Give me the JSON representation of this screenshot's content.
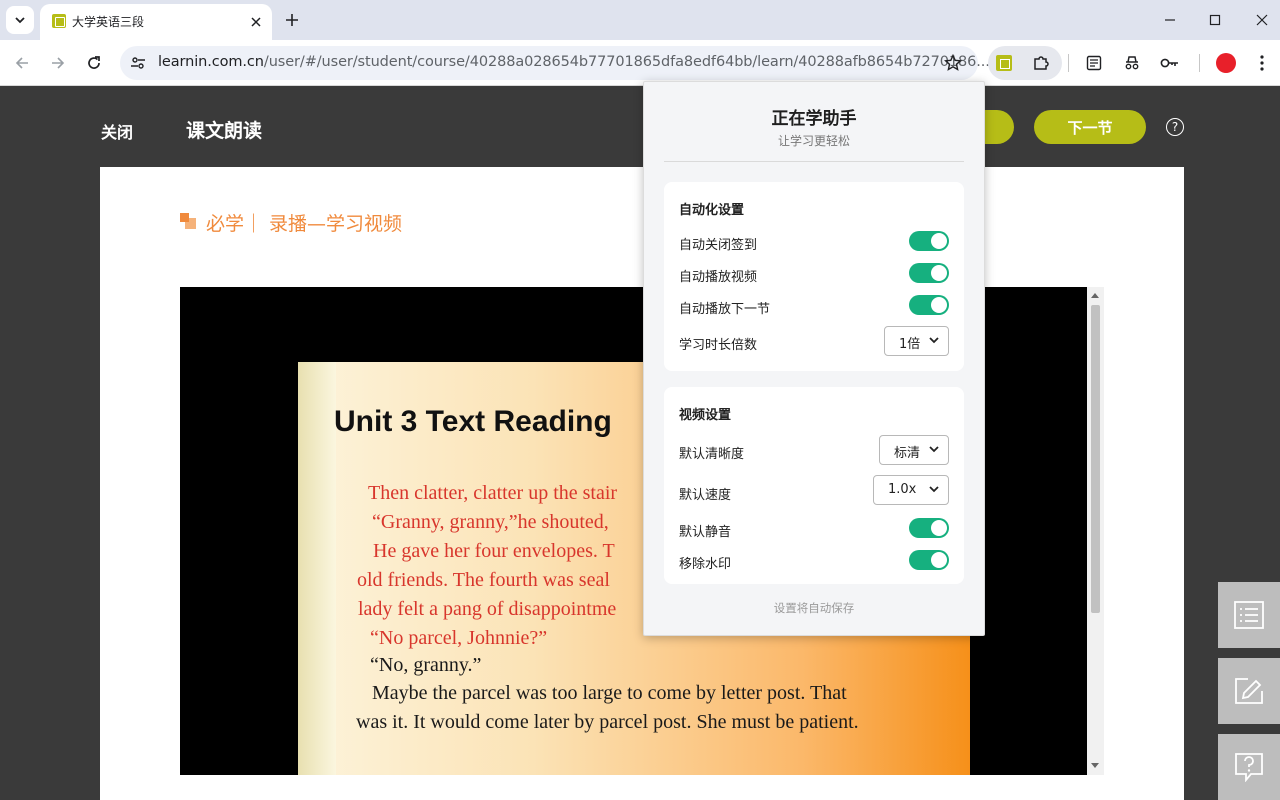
{
  "browser": {
    "tab_title": "大学英语三段",
    "url_host": "learnin.com.cn",
    "url_path": "/user/#/user/student/course/40288a028654b77701865dfa8edf64bb/learn/40288afb8654b7270186..."
  },
  "page": {
    "close_label": "关闭",
    "title": "课文朗读",
    "next_label": "下一节",
    "help_symbol": "?",
    "section_title": "必学｜ 录播—学习视频"
  },
  "slide": {
    "heading": "Unit 3  Text Reading",
    "lines": [
      "Then clatter, clatter up the stair",
      "“Granny, granny,”he shouted,",
      "He gave her four envelopes.  T",
      "old friends.  The fourth was seal",
      "lady felt a pang of disappointme",
      "“No parcel, Johnnie?”",
      "“No, granny.”",
      "Maybe the parcel was too large to come by letter post.  That",
      "was it.  It would come later by parcel post.  She must be patient."
    ]
  },
  "popup": {
    "title": "正在学助手",
    "subtitle": "让学习更轻松",
    "automation": {
      "heading": "自动化设置",
      "auto_close_signin": "自动关闭签到",
      "auto_play_video": "自动播放视频",
      "auto_play_next": "自动播放下一节",
      "duration_multiplier_label": "学习时长倍数",
      "duration_multiplier_value": "1倍",
      "auto_close_signin_on": true,
      "auto_play_video_on": true,
      "auto_play_next_on": true
    },
    "video": {
      "heading": "视频设置",
      "quality_label": "默认清晰度",
      "quality_value": "标清",
      "speed_label": "默认速度",
      "speed_value": "1.0x",
      "mute_label": "默认静音",
      "watermark_label": "移除水印",
      "mute_on": true,
      "watermark_on": true
    },
    "footer": "设置将自动保存"
  },
  "colors": {
    "accent": "#b6bd17",
    "toggle_on": "#16b07f",
    "section_orange": "#f08a3c",
    "slide_red": "#d8362c"
  }
}
